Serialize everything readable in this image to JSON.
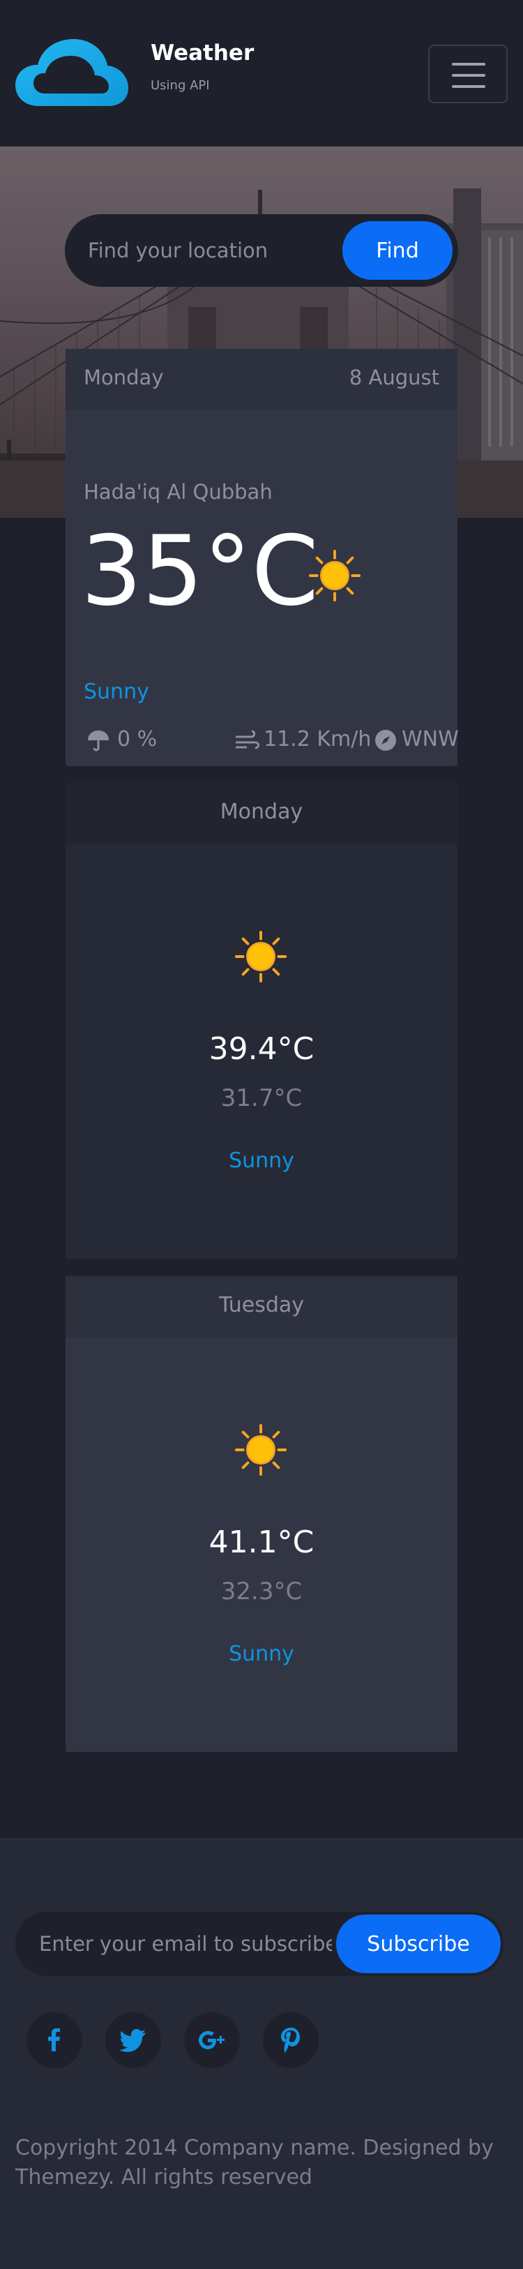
{
  "header": {
    "brand_title": "Weather",
    "brand_subtitle": "Using API",
    "logo_icon": "cloud-icon",
    "menu_icon": "hamburger-menu-icon"
  },
  "search": {
    "placeholder": "Find your location",
    "value": "",
    "button_label": "Find"
  },
  "today": {
    "day": "Monday",
    "date": "8 August",
    "location": "Hada'iq Al Qubbah",
    "temperature": "35°C",
    "icon": "sun-icon",
    "condition": "Sunny",
    "precipitation": "0 %",
    "wind_speed": "11.2 Km/h",
    "wind_direction": "WNW"
  },
  "forecast": [
    {
      "day": "Monday",
      "max": "39.4°C",
      "min": "31.7°C",
      "condition": "Sunny",
      "icon": "sun-icon"
    },
    {
      "day": "Tuesday",
      "max": "41.1°C",
      "min": "32.3°C",
      "condition": "Sunny",
      "icon": "sun-icon"
    }
  ],
  "footer": {
    "subscribe_placeholder": "Enter your email to subscribe...",
    "subscribe_button": "Subscribe",
    "social": [
      "facebook-icon",
      "twitter-icon",
      "google-plus-icon",
      "pinterest-icon"
    ],
    "copyright": "Copyright 2014 Company name. Designed by Themezy. All rights reserved"
  },
  "colors": {
    "background": "#1e202b",
    "card": "#323544",
    "accent_blue": "#0b6cf5",
    "link_blue": "#0f93e1",
    "sun_yellow": "#ffc107"
  }
}
